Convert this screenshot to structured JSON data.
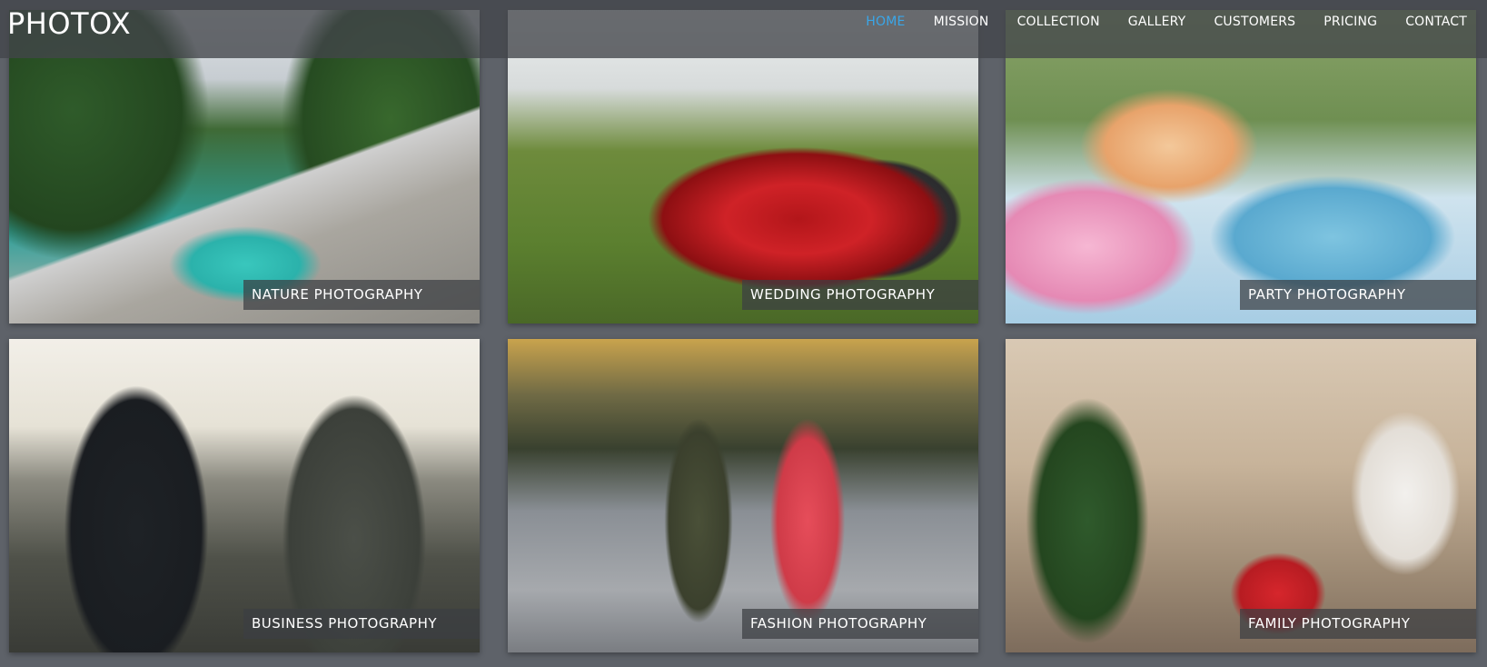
{
  "brand": {
    "logo_text": "PHOTOX"
  },
  "nav": {
    "items": [
      {
        "label": "HOME",
        "active": true
      },
      {
        "label": "MISSION",
        "active": false
      },
      {
        "label": "COLLECTION",
        "active": false
      },
      {
        "label": "GALLERY",
        "active": false
      },
      {
        "label": "CUSTOMERS",
        "active": false
      },
      {
        "label": "PRICING",
        "active": false
      },
      {
        "label": "CONTACT",
        "active": false
      }
    ],
    "active_color": "#3aa6e8"
  },
  "gallery": {
    "tiles": [
      {
        "caption": "NATURE PHOTOGRAPHY"
      },
      {
        "caption": "WEDDING PHOTOGRAPHY"
      },
      {
        "caption": "PARTY PHOTOGRAPHY"
      },
      {
        "caption": "BUSINESS PHOTOGRAPHY"
      },
      {
        "caption": "FASHION PHOTOGRAPHY"
      },
      {
        "caption": "FAMILY PHOTOGRAPHY"
      }
    ]
  },
  "colors": {
    "page_background": "#5e6269",
    "header_overlay": "#42454a",
    "caption_overlay": "#3c3e42"
  }
}
